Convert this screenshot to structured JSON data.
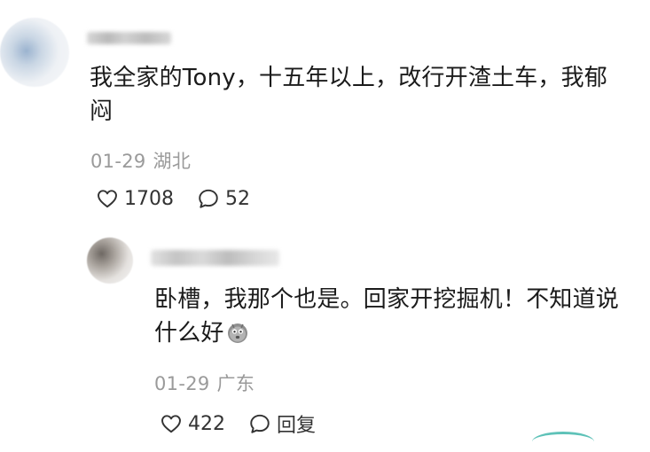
{
  "comments": [
    {
      "text": "我全家的Tony，十五年以上，改行开渣土车，我郁闷",
      "date": "01-29",
      "location": "湖北",
      "likes": "1708",
      "replies": "52"
    },
    {
      "text": "卧槽，我那个也是。回家开挖掘机！不知道说什么好",
      "emoji": "ghost-emoji",
      "date": "01-29",
      "location": "广东",
      "likes": "422",
      "reply_label": "回复"
    }
  ],
  "colors": {
    "text": "#1b1b1b",
    "meta": "#9a9a9a",
    "action": "#333333"
  },
  "icons": {
    "like": "heart-icon",
    "reply": "speech-bubble-icon"
  }
}
